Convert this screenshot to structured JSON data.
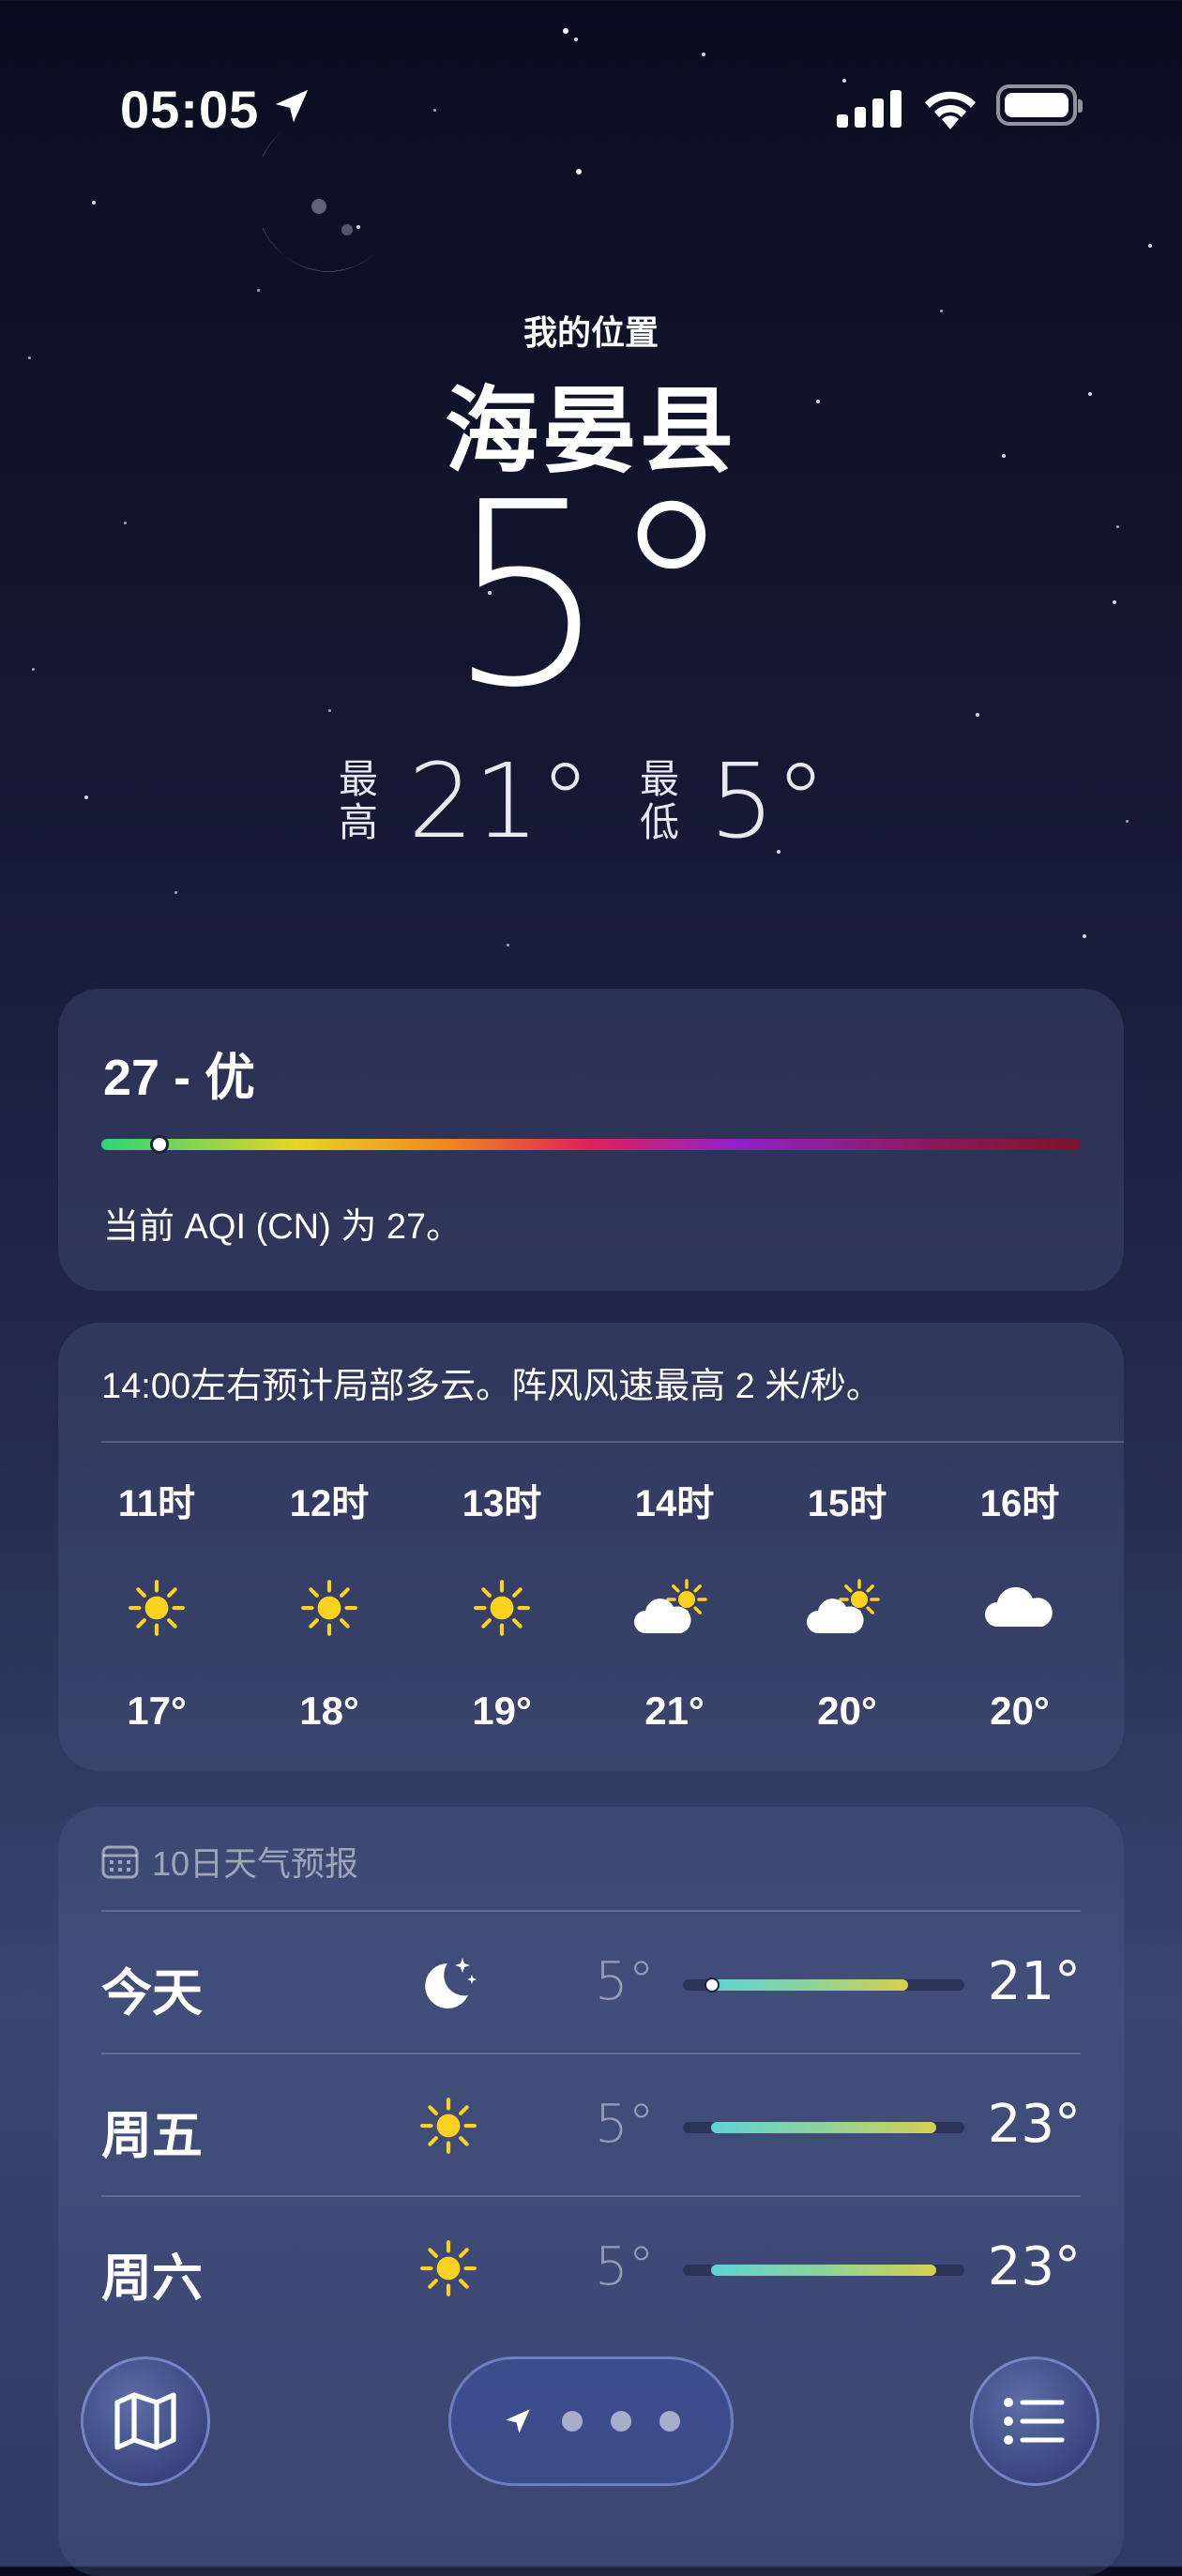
{
  "status_bar": {
    "time": "05:05"
  },
  "header": {
    "my_location": "我的位置",
    "city": "海晏县",
    "temperature": "5°",
    "high_label": "最高",
    "high": "21°",
    "low_label": "最低",
    "low": "5°"
  },
  "aqi": {
    "title": "27 - 优",
    "value": 27,
    "description": "当前 AQI (CN) 为 27。"
  },
  "hourly": {
    "summary": "14:00左右预计局部多云。阵风风速最高 2 米/秒。",
    "hours": [
      {
        "label": "11时",
        "icon": "sun-icon",
        "temp": "17°"
      },
      {
        "label": "12时",
        "icon": "sun-icon",
        "temp": "18°"
      },
      {
        "label": "13时",
        "icon": "sun-icon",
        "temp": "19°"
      },
      {
        "label": "14时",
        "icon": "partly-cloudy-icon",
        "temp": "21°"
      },
      {
        "label": "15时",
        "icon": "partly-cloudy-icon",
        "temp": "20°"
      },
      {
        "label": "16时",
        "icon": "cloud-icon",
        "temp": "20°"
      }
    ]
  },
  "daily": {
    "header": "10日天气预报",
    "days": [
      {
        "day": "今天",
        "icon": "moon-stars-icon",
        "low": "5°",
        "high": "21°",
        "range_start": 0.1,
        "range_end": 0.8,
        "current": 0.1
      },
      {
        "day": "周五",
        "icon": "sun-icon",
        "low": "5°",
        "high": "23°",
        "range_start": 0.1,
        "range_end": 0.9
      },
      {
        "day": "周六",
        "icon": "sun-icon",
        "low": "5°",
        "high": "23°",
        "range_start": 0.1,
        "range_end": 0.9
      }
    ]
  },
  "colors": {
    "sun": "#ffd21f",
    "accent": "#5fd3d6"
  }
}
